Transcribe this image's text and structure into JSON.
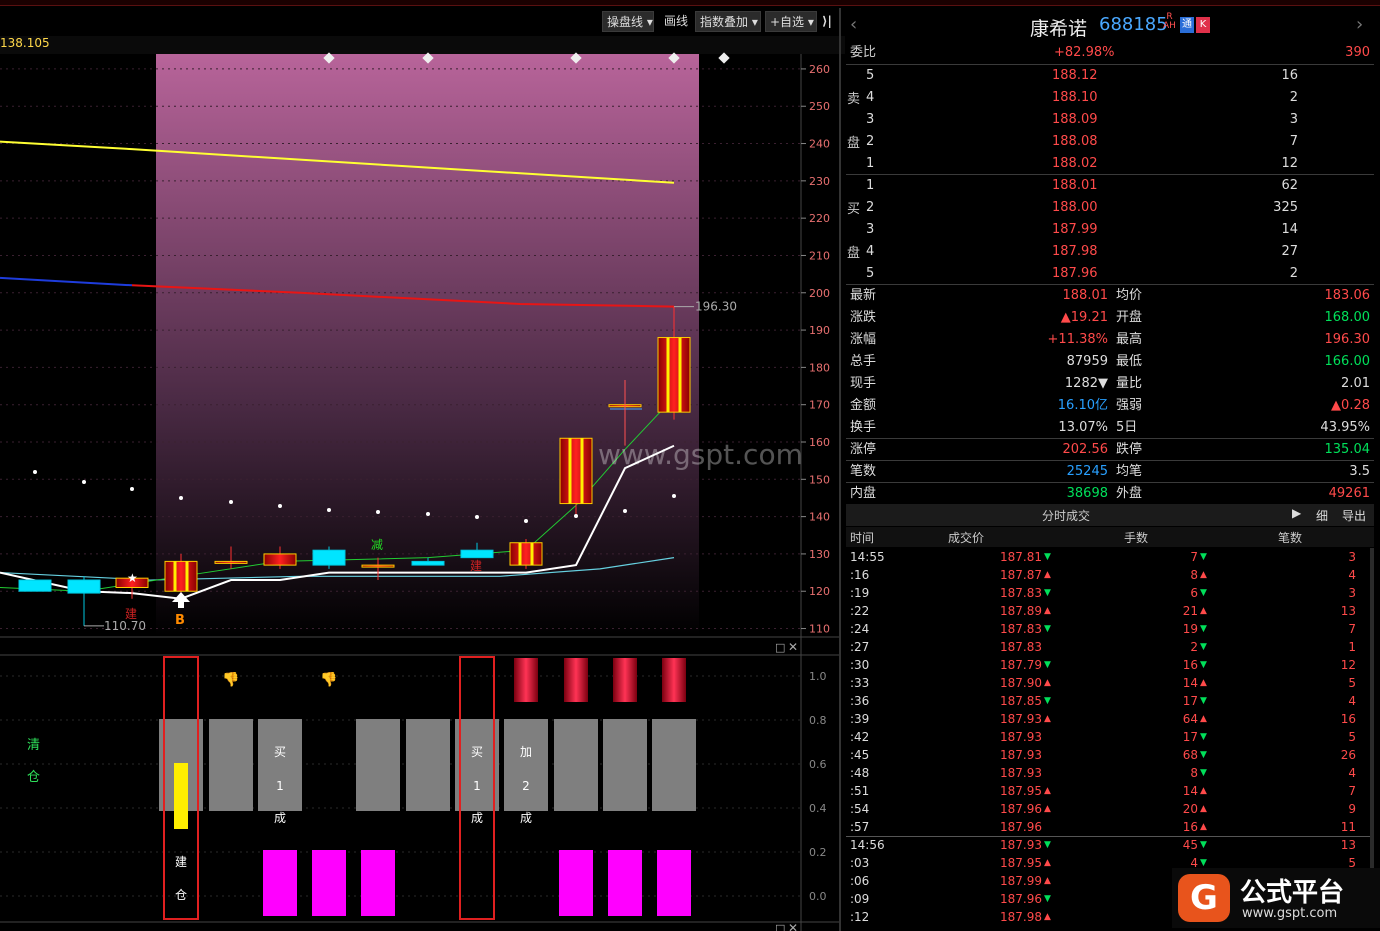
{
  "toolbar": {
    "buttons": [
      "操盘线",
      "画线",
      "指数叠加",
      "+自选"
    ],
    "collapse_icon": "double-chevron-right-icon"
  },
  "chart_header": {
    "left_value": "138.105"
  },
  "colors": {
    "up": "#ff3030",
    "down": "#00e5ff",
    "ma_yellow": "#ffff33",
    "ma_red": "#e81515",
    "ma_blue": "#1e3cdc",
    "highlight_top": "#b8649a",
    "highlight_bottom": "#000000",
    "magenta": "#ff00ff",
    "gray_block": "#7f7f7f"
  },
  "chart_data": [
    {
      "type": "candlestick",
      "ylim": [
        108,
        264
      ],
      "yticks": [
        110,
        120,
        130,
        140,
        150,
        160,
        170,
        180,
        190,
        200,
        210,
        220,
        230,
        240,
        250,
        260
      ],
      "candles": [
        {
          "o": 123,
          "h": 123,
          "l": 120,
          "c": 120
        },
        {
          "o": 123,
          "h": 123,
          "l": 120,
          "c": 120
        },
        {
          "o": 123,
          "h": 124,
          "l": 110.7,
          "c": 119.5
        },
        {
          "o": 121,
          "h": 124,
          "l": 118,
          "c": 123.5
        },
        {
          "o": 120,
          "h": 130,
          "l": 118,
          "c": 128
        },
        {
          "o": 127.5,
          "h": 132,
          "l": 126,
          "c": 128
        },
        {
          "o": 127,
          "h": 132,
          "l": 126,
          "c": 130
        },
        {
          "o": 131,
          "h": 132,
          "l": 126,
          "c": 127
        },
        {
          "o": 127,
          "h": 129,
          "l": 123,
          "c": 127
        },
        {
          "o": 128,
          "h": 129,
          "l": 127,
          "c": 127
        },
        {
          "o": 131,
          "h": 133,
          "l": 129,
          "c": 129
        },
        {
          "o": 127,
          "h": 134,
          "l": 126,
          "c": 133
        },
        {
          "o": 143.5,
          "h": 160,
          "l": 140,
          "c": 161
        },
        {
          "o": 170,
          "h": 176,
          "l": 159,
          "c": 170
        },
        {
          "o": 168,
          "h": 196.3,
          "l": 166,
          "c": 188
        }
      ],
      "annotations": {
        "high_label": "196.30",
        "low_label": "110.70",
        "buy_marker": "B",
        "reduce_marker": "减",
        "build_marker": "建"
      }
    },
    {
      "type": "signal_panel",
      "ylim": [
        -0.05,
        1.05
      ],
      "yticks": [
        "1.0",
        "0.8",
        "0.6",
        "0.4",
        "0.2",
        "0.0"
      ],
      "left_labels": [
        "清",
        "仓"
      ],
      "box1_text": [
        "建",
        "仓"
      ],
      "box2_text": [
        "买",
        "1",
        "成"
      ],
      "gray_texts": [
        [
          "买",
          "1",
          "成"
        ],
        [
          "加",
          "2",
          "成"
        ]
      ]
    }
  ],
  "watermark": "www.gspt.com",
  "logo": {
    "text": "公式平台",
    "url_text": "www.gspt.com"
  },
  "quote": {
    "name": "康希诺",
    "code": "688185",
    "badges": [
      "R",
      "AH",
      "通",
      "K"
    ],
    "weibi_label": "委比",
    "weibi_pct": "+82.98%",
    "weibi_val": "390",
    "sell_label": [
      "卖",
      "盘"
    ],
    "buy_label": [
      "买",
      "盘"
    ],
    "sell": [
      {
        "lvl": "5",
        "price": "188.12",
        "vol": "16"
      },
      {
        "lvl": "4",
        "price": "188.10",
        "vol": "2"
      },
      {
        "lvl": "3",
        "price": "188.09",
        "vol": "3"
      },
      {
        "lvl": "2",
        "price": "188.08",
        "vol": "7"
      },
      {
        "lvl": "1",
        "price": "188.02",
        "vol": "12"
      }
    ],
    "buy": [
      {
        "lvl": "1",
        "price": "188.01",
        "vol": "62"
      },
      {
        "lvl": "2",
        "price": "188.00",
        "vol": "325"
      },
      {
        "lvl": "3",
        "price": "187.99",
        "vol": "14"
      },
      {
        "lvl": "4",
        "price": "187.98",
        "vol": "27"
      },
      {
        "lvl": "5",
        "price": "187.96",
        "vol": "2"
      }
    ],
    "stats": [
      {
        "l1": "最新",
        "v1": "188.01",
        "c1": "red",
        "l2": "均价",
        "v2": "183.06",
        "c2": "red"
      },
      {
        "l1": "涨跌",
        "v1": "▲19.21",
        "c1": "red",
        "l2": "开盘",
        "v2": "168.00",
        "c2": "green"
      },
      {
        "l1": "涨幅",
        "v1": "+11.38%",
        "c1": "red",
        "l2": "最高",
        "v2": "196.30",
        "c2": "red"
      },
      {
        "l1": "总手",
        "v1": "87959",
        "c1": "white",
        "l2": "最低",
        "v2": "166.00",
        "c2": "green"
      },
      {
        "l1": "现手",
        "v1": "1282▼",
        "c1": "white",
        "l2": "量比",
        "v2": "2.01",
        "c2": "white"
      },
      {
        "l1": "金额",
        "v1": "16.10亿",
        "c1": "blue",
        "l2": "强弱",
        "v2": "▲0.28",
        "c2": "red"
      },
      {
        "l1": "换手",
        "v1": "13.07%",
        "c1": "white",
        "l2": "5日",
        "v2": "43.95%",
        "c2": "white"
      },
      {
        "l1": "涨停",
        "v1": "202.56",
        "c1": "red",
        "l2": "跌停",
        "v2": "135.04",
        "c2": "green"
      },
      {
        "l1": "笔数",
        "v1": "25245",
        "c1": "blue",
        "l2": "均笔",
        "v2": "3.5",
        "c2": "white"
      },
      {
        "l1": "内盘",
        "v1": "38698",
        "c1": "green",
        "l2": "外盘",
        "v2": "49261",
        "c2": "red"
      }
    ]
  },
  "trades": {
    "title": "分时成交",
    "btn_detail": "细",
    "btn_export": "导出",
    "headers": [
      "时间",
      "成交价",
      "手数",
      "笔数"
    ],
    "rows": [
      {
        "t": "14:55",
        "p": "187.81",
        "pd": "▼",
        "v": "7",
        "vd": "▼",
        "n": "3"
      },
      {
        "t": ":16",
        "p": "187.87",
        "pd": "▲",
        "v": "8",
        "vd": "▲",
        "n": "4"
      },
      {
        "t": ":19",
        "p": "187.83",
        "pd": "▼",
        "v": "6",
        "vd": "▼",
        "n": "3"
      },
      {
        "t": ":22",
        "p": "187.89",
        "pd": "▲",
        "v": "21",
        "vd": "▲",
        "n": "13"
      },
      {
        "t": ":24",
        "p": "187.83",
        "pd": "▼",
        "v": "19",
        "vd": "▼",
        "n": "7"
      },
      {
        "t": ":27",
        "p": "187.83",
        "pd": "",
        "v": "2",
        "vd": "▼",
        "n": "1"
      },
      {
        "t": ":30",
        "p": "187.79",
        "pd": "▼",
        "v": "16",
        "vd": "▼",
        "n": "12"
      },
      {
        "t": ":33",
        "p": "187.90",
        "pd": "▲",
        "v": "14",
        "vd": "▲",
        "n": "5"
      },
      {
        "t": ":36",
        "p": "187.85",
        "pd": "▼",
        "v": "17",
        "vd": "▼",
        "n": "4"
      },
      {
        "t": ":39",
        "p": "187.93",
        "pd": "▲",
        "v": "64",
        "vd": "▲",
        "n": "16"
      },
      {
        "t": ":42",
        "p": "187.93",
        "pd": "",
        "v": "17",
        "vd": "▼",
        "n": "5"
      },
      {
        "t": ":45",
        "p": "187.93",
        "pd": "",
        "v": "68",
        "vd": "▼",
        "n": "26"
      },
      {
        "t": ":48",
        "p": "187.93",
        "pd": "",
        "v": "8",
        "vd": "▼",
        "n": "4"
      },
      {
        "t": ":51",
        "p": "187.95",
        "pd": "▲",
        "v": "14",
        "vd": "▲",
        "n": "7"
      },
      {
        "t": ":54",
        "p": "187.96",
        "pd": "▲",
        "v": "20",
        "vd": "▲",
        "n": "9"
      },
      {
        "t": ":57",
        "p": "187.96",
        "pd": "",
        "v": "16",
        "vd": "▲",
        "n": "11"
      },
      {
        "t": "14:56",
        "p": "187.93",
        "pd": "▼",
        "v": "45",
        "vd": "▼",
        "n": "13"
      },
      {
        "t": ":03",
        "p": "187.95",
        "pd": "▲",
        "v": "4",
        "vd": "▼",
        "n": "5"
      },
      {
        "t": ":06",
        "p": "187.99",
        "pd": "▲",
        "v": "",
        "vd": "",
        "n": ""
      },
      {
        "t": ":09",
        "p": "187.96",
        "pd": "▼",
        "v": "",
        "vd": "",
        "n": ""
      },
      {
        "t": ":12",
        "p": "187.98",
        "pd": "▲",
        "v": "",
        "vd": "",
        "n": ""
      }
    ]
  }
}
